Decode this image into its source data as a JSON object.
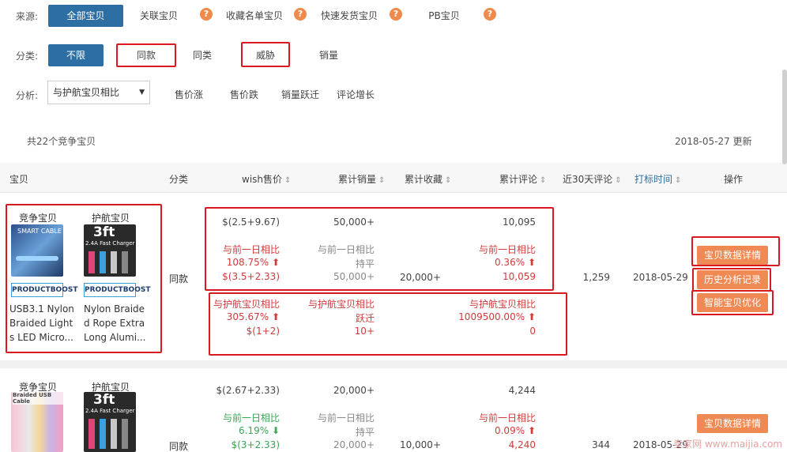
{
  "filters": {
    "source_label": "来源:",
    "source_options": [
      "全部宝贝",
      "关联宝贝",
      "收藏名单宝贝",
      "快速发货宝贝",
      "PB宝贝"
    ],
    "category_label": "分类:",
    "category_options": [
      "不限",
      "同款",
      "同类",
      "威胁",
      "销量"
    ],
    "analysis_label": "分析:",
    "analysis_select": "与护航宝贝相比",
    "analysis_options": [
      "售价涨",
      "售价跌",
      "销量跃迁",
      "评论增长"
    ],
    "help_icon": "?"
  },
  "summary": {
    "count_text": "共22个竞争宝贝",
    "update_text": "2018-05-27 更新"
  },
  "table": {
    "headers": [
      "宝贝",
      "分类",
      "wish售价",
      "累计销量",
      "累计收藏",
      "累计评论",
      "近30天评论",
      "打标时间",
      "操作"
    ],
    "sort_icon": "⇕",
    "rows": [
      {
        "competitor_label": "竞争宝贝",
        "escort_label": "护航宝贝",
        "competitor_title": "USB3.1 Nylon Braided Light s LED Micro...",
        "escort_title": "Nylon Braide d Rope Extra Long Alumi...",
        "competitor_badge": "PRODUCTBOOST",
        "escort_badge": "PRODUCTBOOST",
        "competitor_thumb_text": "SMART CABLE",
        "escort_thumb_text": "3ft",
        "escort_thumb_sub": "2.4A Fast Charger",
        "category": "同款",
        "price": "$(2.5+9.67)",
        "sales": "50,000+",
        "reviews": "10,095",
        "day_compare_label": "与前一日相比",
        "price_day_pct": "108.75%",
        "price_day_arrow": "⬆",
        "price_day_value": "$(3.5+2.33)",
        "sales_day_status": "持平",
        "sales_day_value": "50,000+",
        "favorites": "20,000+",
        "reviews_day_pct": "0.36%",
        "reviews_day_arrow": "⬆",
        "reviews_day_value": "10,059",
        "reviews_30d": "1,259",
        "tag_date": "2018-05-29",
        "escort_compare_label": "与护航宝贝相比",
        "price_escort_pct": "305.67%",
        "price_escort_arrow": "⬆",
        "price_escort_value": "$(1+2)",
        "sales_escort_status": "跃迁",
        "sales_escort_value": "10+",
        "reviews_escort_pct": "1009500.00%",
        "reviews_escort_arrow": "⬆",
        "reviews_escort_value": "0",
        "actions": [
          "宝贝数据详情",
          "历史分析记录",
          "智能宝贝优化"
        ]
      },
      {
        "competitor_label": "竞争宝贝",
        "escort_label": "护航宝贝",
        "competitor_thumb_text": "Braided USB Cable",
        "escort_thumb_text": "3ft",
        "escort_thumb_sub": "2.4A Fast Charger",
        "category": "同款",
        "price": "$(2.67+2.33)",
        "sales": "20,000+",
        "reviews": "4,244",
        "day_compare_label": "与前一日相比",
        "price_day_pct": "6.19%",
        "price_day_arrow": "⬇",
        "price_day_value": "$(3+2.33)",
        "sales_day_status": "持平",
        "sales_day_value": "20,000+",
        "favorites": "10,000+",
        "reviews_day_pct": "0.09%",
        "reviews_day_arrow": "⬆",
        "reviews_day_value": "4,240",
        "reviews_30d": "344",
        "tag_date": "2018-05-29",
        "actions": [
          "宝贝数据详情"
        ]
      }
    ]
  },
  "watermark": "卖家网 www.maijia.com",
  "colors": {
    "primary": "#2e6fa3",
    "orange": "#f08a54",
    "red": "#d03b3b",
    "green": "#3aa655",
    "highlight": "#d9191f"
  }
}
